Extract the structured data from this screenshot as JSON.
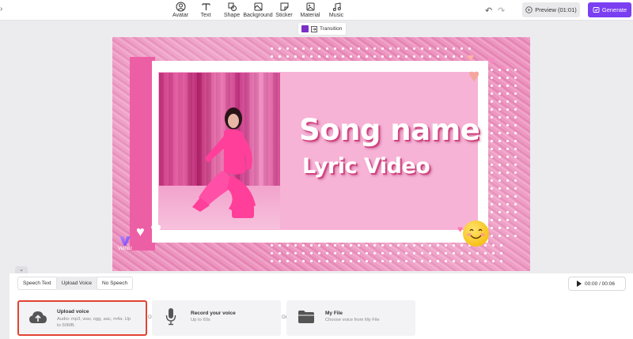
{
  "toolbar": {
    "tools": [
      {
        "label": "Avatar",
        "icon": "avatar-icon"
      },
      {
        "label": "Text",
        "icon": "text-icon"
      },
      {
        "label": "Shape",
        "icon": "shape-icon"
      },
      {
        "label": "Background",
        "icon": "background-icon"
      },
      {
        "label": "Sticker",
        "icon": "sticker-icon"
      },
      {
        "label": "Material",
        "icon": "material-icon"
      },
      {
        "label": "Music",
        "icon": "music-icon"
      }
    ],
    "preview_label": "Preview (01:01)",
    "generate_label": "Generate"
  },
  "transition": {
    "label": "Transition",
    "swatch_color": "#7a2fc6"
  },
  "canvas": {
    "song_title": "Song name",
    "subtitle": "Lyric Video",
    "brand": "Vidnoz"
  },
  "voice_panel": {
    "tabs": [
      {
        "label": "Speech Text",
        "active": false
      },
      {
        "label": "Upload Voice",
        "active": true
      },
      {
        "label": "No Speech",
        "active": false
      }
    ],
    "player_time": "00:00 / 00:06",
    "or_label": "Or",
    "options": [
      {
        "title": "Upload voice",
        "description": "Audio: mp3, wav, ogg, aac, m4a. Up to 50MB.",
        "icon": "cloud-upload-icon"
      },
      {
        "title": "Record your voice",
        "description": "Up to 60s",
        "icon": "microphone-icon"
      },
      {
        "title": "My File",
        "description": "Choose voice from My File",
        "icon": "folder-icon"
      }
    ]
  },
  "colors": {
    "accent": "#7b3ff2",
    "highlight_border": "#e24333",
    "canvas_pink": "#ec5fa5"
  }
}
